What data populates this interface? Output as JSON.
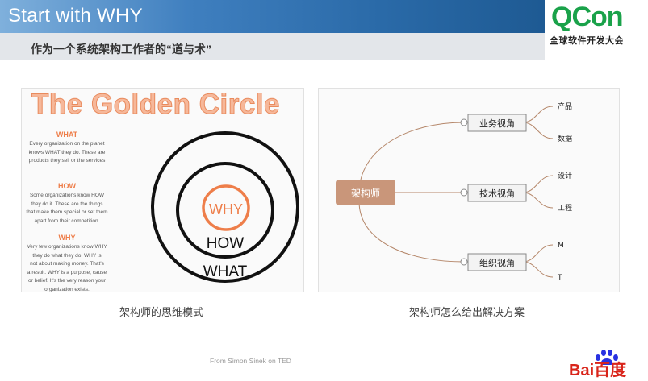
{
  "header": {
    "title": "Start with WHY",
    "subtitle": "作为一个系统架构工作者的“道与术”"
  },
  "logo": {
    "brand": "QCon",
    "tagline": "全球软件开发大会"
  },
  "golden_circle": {
    "title": "The Golden Circle",
    "sections": [
      {
        "heading": "WHAT",
        "text": [
          "Every organization on the planet",
          "knows WHAT they do. These are",
          "products they sell or the services"
        ]
      },
      {
        "heading": "HOW",
        "text": [
          "Some organizations know HOW",
          "they do it. These are the things",
          "that make them special or set them",
          "apart from their competition."
        ]
      },
      {
        "heading": "WHY",
        "text": [
          "Very few organizations know WHY",
          "they do what they do. WHY is",
          "not about making money. That's",
          "a result. WHY is a purpose, cause",
          "or belief. It's the very reason your",
          "organization exists."
        ]
      }
    ],
    "circle_labels": {
      "inner": "WHY",
      "middle": "HOW",
      "outer": "WHAT"
    }
  },
  "mindmap": {
    "root": "架构师",
    "branches": [
      {
        "label": "业务视角",
        "leaves": [
          "产品",
          "数据"
        ]
      },
      {
        "label": "技术视角",
        "leaves": [
          "设计",
          "工程"
        ]
      },
      {
        "label": "组织视角",
        "leaves": [
          "M",
          "T"
        ]
      }
    ]
  },
  "captions": {
    "left": "架构师的思维模式",
    "right": "架构师怎么给出解决方案"
  },
  "credit": "From Simon Sinek on TED",
  "footer_logo": "Bai百度",
  "colors": {
    "accent_orange": "#ee7e4a",
    "root_node": "#c9967a",
    "qcon_green": "#1aa24a",
    "baidu_red": "#d9241a"
  }
}
